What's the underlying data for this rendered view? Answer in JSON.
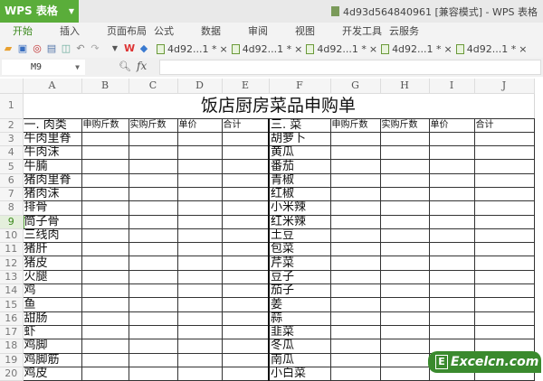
{
  "app": {
    "name": "WPS 表格",
    "window_title": "4d93d564840961 [兼容模式] - WPS 表格"
  },
  "menu": [
    "开始",
    "插入",
    "页面布局",
    "公式",
    "数据",
    "审阅",
    "视图",
    "开发工具",
    "云服务"
  ],
  "doc_tabs": [
    "4d92...1 *",
    "4d92...1 *",
    "4d92...1 *",
    "4d92...1 *",
    "4d92...1 *"
  ],
  "formula": {
    "name_box": "M9",
    "fx": "fx",
    "value": ""
  },
  "columns": [
    "A",
    "B",
    "C",
    "D",
    "E",
    "F",
    "G",
    "H",
    "I",
    "J"
  ],
  "active_row": 9,
  "sheet": {
    "title": "饭店厨房菜品申购单",
    "headers": [
      "一. 肉类",
      "申购斤数",
      "实购斤数",
      "单价",
      "合计",
      "三. 菜",
      "申购斤数",
      "实购斤数",
      "单价",
      "合计"
    ],
    "meat": [
      "牛肉里脊",
      "牛肉沫",
      "牛腩",
      "猪肉里脊",
      "猪肉沫",
      "排骨",
      "筒子骨",
      "三线肉",
      "猪肝",
      "猪皮",
      "火腿",
      "鸡",
      "鱼",
      "甜肠",
      "虾",
      "鸡脚",
      "鸡脚筋",
      "鸡皮"
    ],
    "veg": [
      "胡萝卜",
      "黄瓜",
      "番茄",
      "青椒",
      "红椒",
      "小米辣",
      "红米辣",
      "土豆",
      "包菜",
      "芹菜",
      "豆子",
      "茄子",
      "姜",
      "蒜",
      "韭菜",
      "冬瓜",
      "南瓜",
      "小白菜"
    ]
  },
  "watermark": "Excelcn.com"
}
